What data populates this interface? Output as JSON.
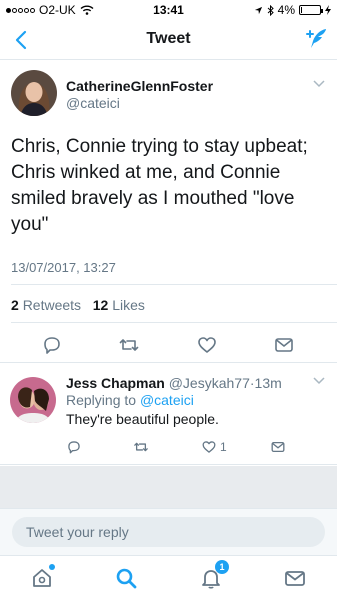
{
  "status_bar": {
    "carrier": "O2-UK",
    "time": "13:41",
    "battery": "4%",
    "battery_level": 0.04
  },
  "nav": {
    "title": "Tweet"
  },
  "tweet": {
    "author_name": "CatherineGlennFoster",
    "author_handle": "@cateici",
    "text": "Chris, Connie trying to stay upbeat; Chris winked at me, and Connie smiled bravely as I mouthed \"love you\"",
    "timestamp": "13/07/2017, 13:27",
    "retweets_count": "2",
    "retweets_label": "Retweets",
    "likes_count": "12",
    "likes_label": "Likes"
  },
  "reply": {
    "author_name": "Jess Chapman",
    "author_handle": "@Jesykah77",
    "time_ago": "13m",
    "replying_prefix": "Replying to",
    "replying_to": "@cateici",
    "text": "They're beautiful people.",
    "likes_count": "1"
  },
  "composer": {
    "placeholder": "Tweet your reply"
  },
  "tabbar": {
    "notifications_badge": "1"
  },
  "colors": {
    "accent": "#1da1f2",
    "secondary_text": "#657786",
    "divider": "#e1e8ed"
  }
}
